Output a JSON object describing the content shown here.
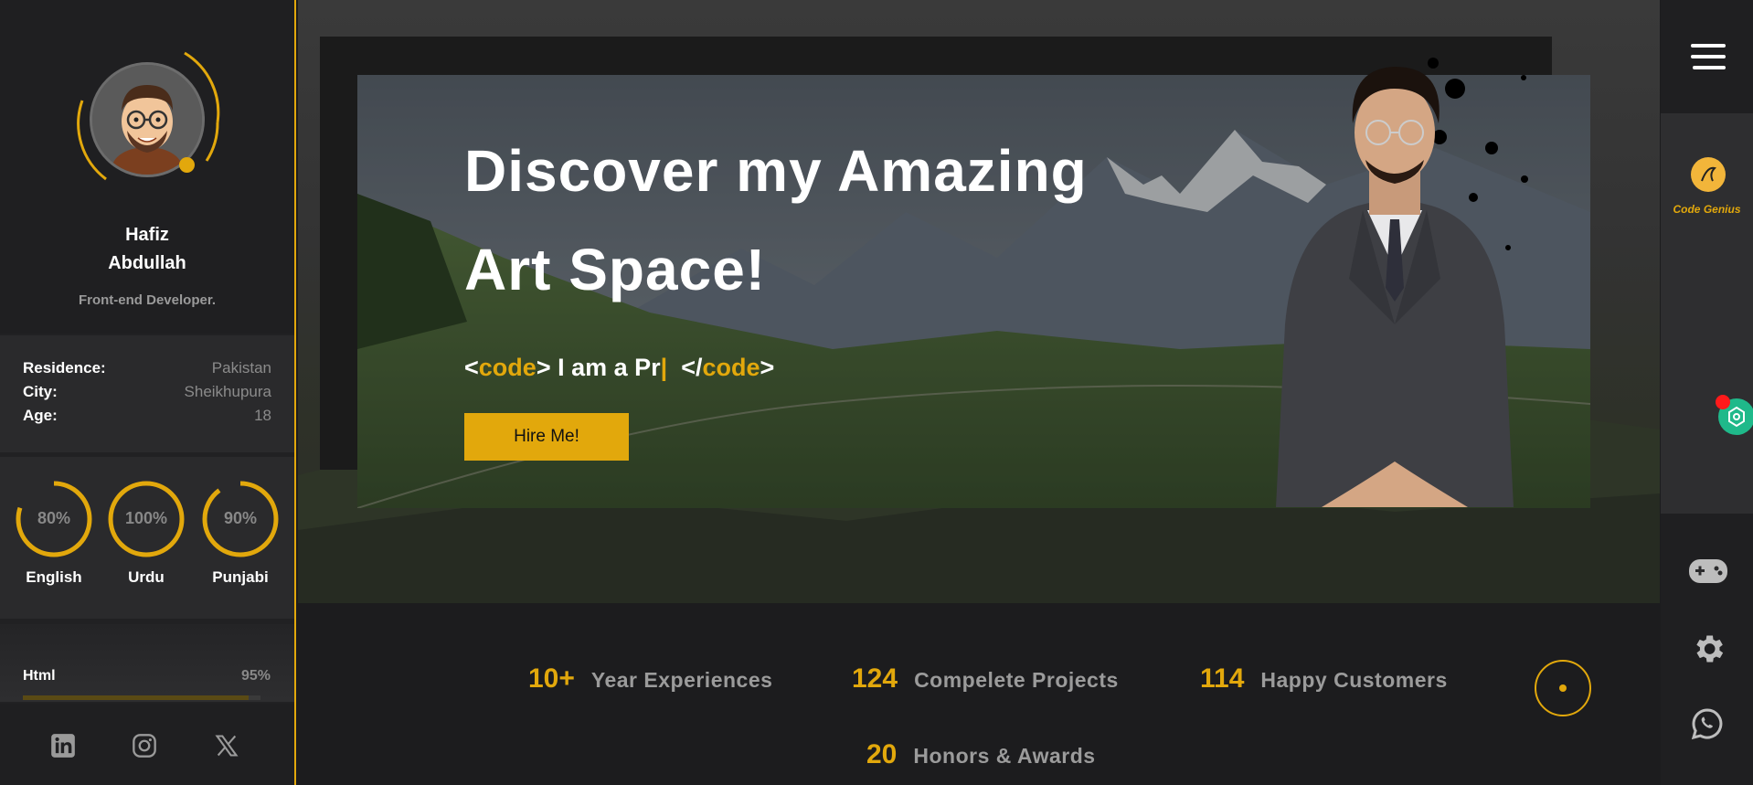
{
  "profile": {
    "first_name": "Hafiz",
    "last_name": "Abdullah",
    "role": "Front-end Developer."
  },
  "info": [
    {
      "label": "Residence:",
      "value": "Pakistan"
    },
    {
      "label": "City:",
      "value": "Sheikhupura"
    },
    {
      "label": "Age:",
      "value": "18"
    }
  ],
  "languages": [
    {
      "name": "English",
      "percent_label": "80%",
      "level": 0.8
    },
    {
      "name": "Urdu",
      "percent_label": "100%",
      "level": 1.0
    },
    {
      "name": "Punjabi",
      "percent_label": "90%",
      "level": 0.9
    }
  ],
  "skills": [
    {
      "name": "Html",
      "percent_label": "95%",
      "level": 0.95
    }
  ],
  "social": [
    "linkedin-icon",
    "instagram-icon",
    "x-icon"
  ],
  "hero": {
    "title_line1": "Discover my Amazing",
    "title_line2": "Art Space!",
    "code_open": "code",
    "typed_text": "I am a Pr",
    "code_close": "code",
    "hire_label": "Hire Me!"
  },
  "stats": [
    {
      "num": "10+",
      "label": "Year Experiences"
    },
    {
      "num": "124",
      "label": "Compelete Projects"
    },
    {
      "num": "114",
      "label": "Happy Customers"
    },
    {
      "num": "20",
      "label": "Honors & Awards"
    }
  ],
  "rail": {
    "brand": "Code Genius",
    "icons": [
      "menu-icon",
      "gamepad-icon",
      "gear-icon",
      "whatsapp-icon"
    ]
  },
  "colors": {
    "accent": "#e2a80c",
    "background": "#1c1c1e",
    "panel": "#2a2a2c"
  }
}
